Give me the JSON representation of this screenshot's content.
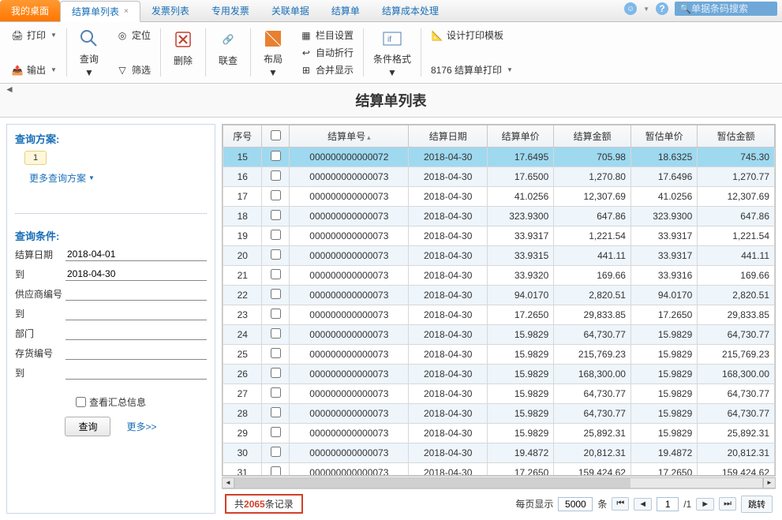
{
  "tabs": [
    "我的桌面",
    "结算单列表",
    "发票列表",
    "专用发票",
    "关联单据",
    "结算单",
    "结算成本处理"
  ],
  "search_placeholder": "单据条码搜索",
  "ribbon": {
    "print": "打印",
    "output": "输出",
    "query": "查询",
    "locate": "定位",
    "filter": "筛选",
    "delete": "删除",
    "link": "联查",
    "layout": "布局",
    "column_set": "栏目设置",
    "auto_wrap": "自动折行",
    "merge_disp": "合并显示",
    "cond_fmt": "条件格式",
    "design_tpl": "设计打印模板",
    "print_8176": "8176 结算单打印"
  },
  "page_title": "结算单列表",
  "left": {
    "scheme": "查询方案:",
    "scheme_num": "1",
    "more_scheme": "更多查询方案",
    "cond": "查询条件:",
    "labels": {
      "date": "结算日期",
      "to": "到",
      "supplier": "供应商编号",
      "dept": "部门",
      "stock": "存货编号"
    },
    "date_from": "2018-04-01",
    "date_to": "2018-04-30",
    "chk_summary": "查看汇总信息",
    "btn_query": "查询",
    "link_more": "更多>>"
  },
  "cols": [
    "序号",
    "",
    "结算单号",
    "结算日期",
    "结算单价",
    "结算金额",
    "暂估单价",
    "暂估金额"
  ],
  "rows": [
    {
      "seq": "15",
      "no": "000000000000072",
      "date": "2018-04-30",
      "p": "17.6495",
      "amt": "705.98",
      "ep": "18.6325",
      "eamt": "745.30",
      "sel": true
    },
    {
      "seq": "16",
      "no": "000000000000073",
      "date": "2018-04-30",
      "p": "17.6500",
      "amt": "1,270.80",
      "ep": "17.6496",
      "eamt": "1,270.77"
    },
    {
      "seq": "17",
      "no": "000000000000073",
      "date": "2018-04-30",
      "p": "41.0256",
      "amt": "12,307.69",
      "ep": "41.0256",
      "eamt": "12,307.69"
    },
    {
      "seq": "18",
      "no": "000000000000073",
      "date": "2018-04-30",
      "p": "323.9300",
      "amt": "647.86",
      "ep": "323.9300",
      "eamt": "647.86"
    },
    {
      "seq": "19",
      "no": "000000000000073",
      "date": "2018-04-30",
      "p": "33.9317",
      "amt": "1,221.54",
      "ep": "33.9317",
      "eamt": "1,221.54"
    },
    {
      "seq": "20",
      "no": "000000000000073",
      "date": "2018-04-30",
      "p": "33.9315",
      "amt": "441.11",
      "ep": "33.9317",
      "eamt": "441.11"
    },
    {
      "seq": "21",
      "no": "000000000000073",
      "date": "2018-04-30",
      "p": "33.9320",
      "amt": "169.66",
      "ep": "33.9316",
      "eamt": "169.66"
    },
    {
      "seq": "22",
      "no": "000000000000073",
      "date": "2018-04-30",
      "p": "94.0170",
      "amt": "2,820.51",
      "ep": "94.0170",
      "eamt": "2,820.51"
    },
    {
      "seq": "23",
      "no": "000000000000073",
      "date": "2018-04-30",
      "p": "17.2650",
      "amt": "29,833.85",
      "ep": "17.2650",
      "eamt": "29,833.85"
    },
    {
      "seq": "24",
      "no": "000000000000073",
      "date": "2018-04-30",
      "p": "15.9829",
      "amt": "64,730.77",
      "ep": "15.9829",
      "eamt": "64,730.77"
    },
    {
      "seq": "25",
      "no": "000000000000073",
      "date": "2018-04-30",
      "p": "15.9829",
      "amt": "215,769.23",
      "ep": "15.9829",
      "eamt": "215,769.23"
    },
    {
      "seq": "26",
      "no": "000000000000073",
      "date": "2018-04-30",
      "p": "15.9829",
      "amt": "168,300.00",
      "ep": "15.9829",
      "eamt": "168,300.00"
    },
    {
      "seq": "27",
      "no": "000000000000073",
      "date": "2018-04-30",
      "p": "15.9829",
      "amt": "64,730.77",
      "ep": "15.9829",
      "eamt": "64,730.77"
    },
    {
      "seq": "28",
      "no": "000000000000073",
      "date": "2018-04-30",
      "p": "15.9829",
      "amt": "64,730.77",
      "ep": "15.9829",
      "eamt": "64,730.77"
    },
    {
      "seq": "29",
      "no": "000000000000073",
      "date": "2018-04-30",
      "p": "15.9829",
      "amt": "25,892.31",
      "ep": "15.9829",
      "eamt": "25,892.31"
    },
    {
      "seq": "30",
      "no": "000000000000073",
      "date": "2018-04-30",
      "p": "19.4872",
      "amt": "20,812.31",
      "ep": "19.4872",
      "eamt": "20,812.31"
    },
    {
      "seq": "31",
      "no": "000000000000073",
      "date": "2018-04-30",
      "p": "17.2650",
      "amt": "159,424.62",
      "ep": "17.2650",
      "eamt": "159,424.62"
    }
  ],
  "footer": {
    "total_pre": "共",
    "total_n": "2065",
    "total_suf": "条记录",
    "per_page_pre": "每页显示",
    "per_page_n": "5000",
    "per_page_suf": "条",
    "page_cur": "1",
    "page_total": "/1",
    "jump": "跳转"
  }
}
